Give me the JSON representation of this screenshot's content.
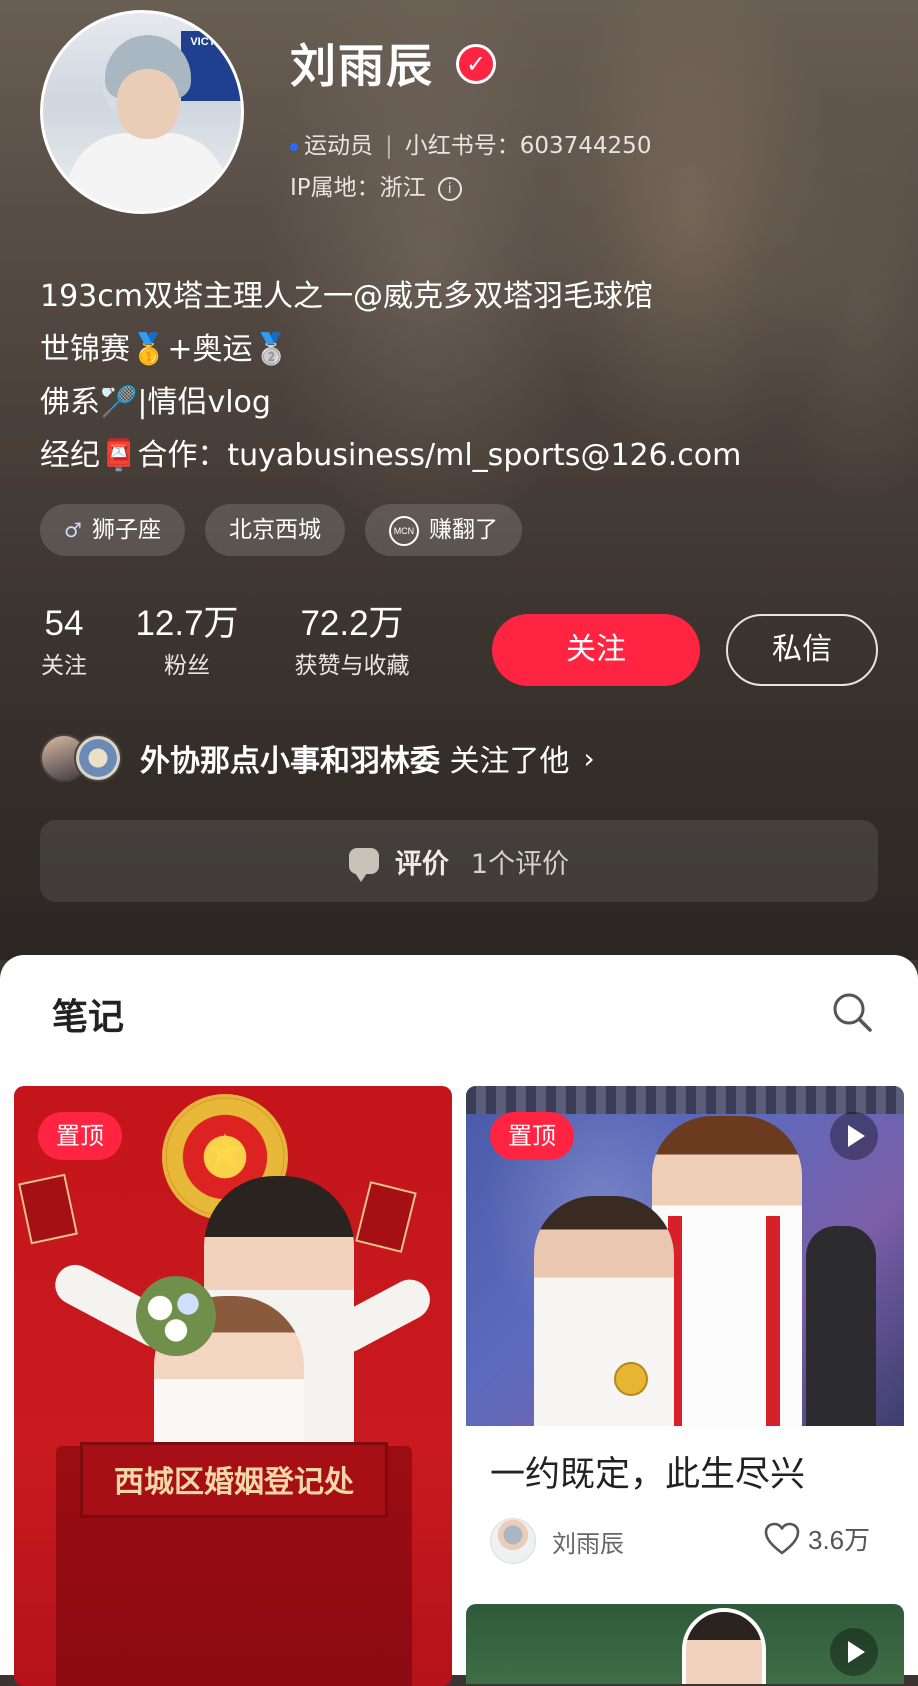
{
  "profile": {
    "name": "刘雨辰",
    "role": "运动员",
    "xhs_id": "小红书号：603744250",
    "ip": "IP属地：浙江",
    "avatar_sign": "VICTOR"
  },
  "bio": [
    "193cm双塔主理人之一@威克多双塔羽毛球馆",
    "世锦赛🥇+奥运🥈",
    "佛系🏸|情侣vlog",
    "经纪📮合作：tuyabusiness/ml_sports@126.com"
  ],
  "tags": [
    {
      "label": "狮子座",
      "icon": "male-icon"
    },
    {
      "label": "北京西城",
      "icon": ""
    },
    {
      "label": "赚翻了",
      "icon": "mcn-icon",
      "icon_text": "MCN"
    }
  ],
  "stats": {
    "following": {
      "value": "54",
      "label": "关注"
    },
    "fans": {
      "value": "12.7万",
      "label": "粉丝"
    },
    "likes": {
      "value": "72.2万",
      "label": "获赞与收藏"
    }
  },
  "buttons": {
    "follow": "关注",
    "message": "私信"
  },
  "mutual": {
    "names": "外协那点小事和羽林委",
    "suffix": "关注了他"
  },
  "review": {
    "label": "评价",
    "count": "1个评价"
  },
  "notes": {
    "title": "笔记",
    "cards": [
      {
        "badge": "置顶",
        "sign_text": "西城区婚姻登记处"
      },
      {
        "badge": "置顶",
        "title": "一约既定，此生尽兴",
        "author": "刘雨辰",
        "likes": "3.6万"
      }
    ]
  },
  "colors": {
    "accent": "#ff2442",
    "sheet": "#ffffff"
  }
}
